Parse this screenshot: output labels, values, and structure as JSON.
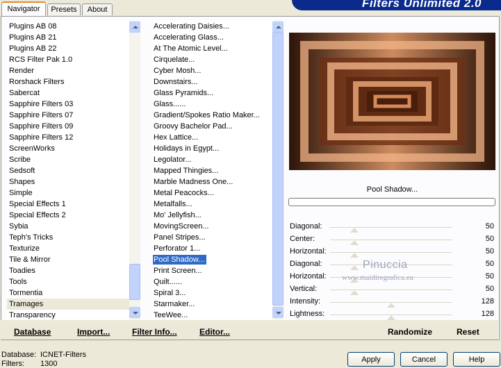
{
  "tabs": [
    "Navigator",
    "Presets",
    "About"
  ],
  "banner": "Filters Unlimited 2.0",
  "categories": [
    "Plugins AB 08",
    "Plugins AB 21",
    "Plugins AB 22",
    "RCS Filter Pak 1.0",
    "Render",
    "Rorshack Filters",
    "Sabercat",
    "Sapphire Filters 03",
    "Sapphire Filters 07",
    "Sapphire Filters 09",
    "Sapphire Filters 12",
    "ScreenWorks",
    "Scribe",
    "Sedsoft",
    "Shapes",
    "Simple",
    "Special Effects 1",
    "Special Effects 2",
    "Sybia",
    "Teph's Tricks",
    "Texturize",
    "Tile & Mirror",
    "Toadies",
    "Tools",
    "Tormentia",
    "Tramages",
    "Transparency"
  ],
  "selected_category": "Tramages",
  "filters": [
    "Accelerating Daisies...",
    "Accelerating Glass...",
    "At The Atomic Level...",
    "Cirquelate...",
    "Cyber Mosh...",
    "Downstairs...",
    "Glass Pyramids...",
    "Glass......",
    "Gradient/Spokes Ratio Maker...",
    "Groovy Bachelor Pad...",
    "Hex Lattice...",
    "Holidays in Egypt...",
    "Legolator...",
    "Mapped Thingies...",
    "Marble Madness One...",
    "Metal Peacocks...",
    "Metalfalls...",
    "Mo' Jellyfish...",
    "MovingScreen...",
    "Panel Stripes...",
    "Perforator 1...",
    "Pool Shadow...",
    "Print Screen...",
    "Quilt......",
    "Spiral 3...",
    "Starmaker...",
    "TeeWee..."
  ],
  "selected_filter": "Pool Shadow...",
  "preview_filter_name": "Pool Shadow...",
  "sliders": [
    {
      "label": "Diagonal:",
      "value": "50",
      "level": 0.2
    },
    {
      "label": "Center:",
      "value": "50",
      "level": 0.2
    },
    {
      "label": "Horizontal:",
      "value": "50",
      "level": 0.2
    },
    {
      "label": "Diagonal:",
      "value": "50",
      "level": 0.2
    },
    {
      "label": "Horizontal:",
      "value": "50",
      "level": 0.2
    },
    {
      "label": "Vertical:",
      "value": "50",
      "level": 0.2
    },
    {
      "label": "Intensity:",
      "value": "128",
      "level": 0.5
    },
    {
      "label": "Lightness:",
      "value": "128",
      "level": 0.5
    }
  ],
  "bottom_actions": {
    "database": "Database",
    "import": "Import...",
    "filter_info": "Filter Info...",
    "editor": "Editor...",
    "randomize": "Randomize",
    "reset": "Reset"
  },
  "status": {
    "database_label": "Database:",
    "database_value": "ICNET-Filters",
    "filters_label": "Filters:",
    "filters_value": "1300"
  },
  "buttons": {
    "apply": "Apply",
    "cancel": "Cancel",
    "help": "Help"
  },
  "watermark": {
    "name": "Pinuccia",
    "url": "www.maidiregrafica.eu"
  },
  "colors": {
    "selection": "#316ac5",
    "banner": "#0a2a8c",
    "tab_highlight": "#e68b2c"
  }
}
